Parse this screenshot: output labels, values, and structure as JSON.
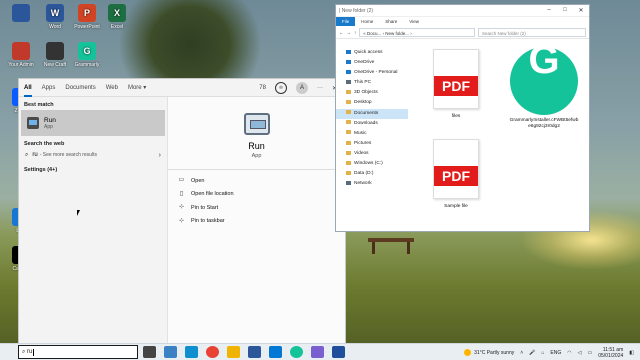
{
  "desktop": {
    "icons": [
      {
        "label": "",
        "letter": "",
        "color": "#2b579a"
      },
      {
        "label": "Word",
        "letter": "W",
        "color": "#2b579a"
      },
      {
        "label": "PowerPoint",
        "letter": "P",
        "color": "#d04423"
      },
      {
        "label": "Excel",
        "letter": "X",
        "color": "#1d6f42"
      },
      {
        "label": "Your Admin",
        "letter": "",
        "color": "#c0392b"
      },
      {
        "label": "New Craft",
        "letter": "",
        "color": "#333333"
      },
      {
        "label": "Grammarly",
        "letter": "G",
        "color": "#15c39a"
      },
      {
        "label": "Zoom",
        "letter": "",
        "color": "#0b5cff"
      },
      {
        "label": "Link",
        "letter": "",
        "color": "#1976d2"
      },
      {
        "label": "CapCut",
        "letter": "",
        "color": "#000000"
      }
    ]
  },
  "start_menu": {
    "tabs": [
      "All",
      "Apps",
      "Documents",
      "Web",
      "More"
    ],
    "active_tab": "All",
    "reward_points": "78",
    "avatar_letter": "A",
    "more_dots": "···",
    "close_glyph": "✕",
    "best_match_label": "Best match",
    "best_match": {
      "title": "Run",
      "subtitle": "App"
    },
    "search_web_label": "Search the web",
    "search_web_query": "ru",
    "search_web_more": "- See more search results",
    "settings_label": "Settings (4+)",
    "preview": {
      "title": "Run",
      "subtitle": "App",
      "actions": [
        "Open",
        "Open file location",
        "Pin to Start",
        "Pin to taskbar"
      ]
    }
  },
  "explorer": {
    "title": "| New folder (2)",
    "ribbon_tabs": [
      "File",
      "Home",
      "Share",
      "View"
    ],
    "breadcrumb": "« Docu... › New folde... ›",
    "search_placeholder": "Search New folder (2)",
    "nav_items": [
      "Quick access",
      "OneDrive",
      "OneDrive - Personal",
      "This PC",
      "3D Objects",
      "Desktop",
      "Documents",
      "Downloads",
      "Music",
      "Pictures",
      "Videos",
      "Windows (C:)",
      "Data (D:)",
      "Network"
    ],
    "selected_nav": "Documents",
    "files": [
      {
        "name": "files",
        "type": "pdf"
      },
      {
        "name": "GrammarlyInstaller.cFWBt5efwb e6g92cj3r0dg2",
        "type": "grammarly"
      },
      {
        "name": "Sample file",
        "type": "pdf"
      }
    ],
    "pdf_label": "PDF"
  },
  "taskbar": {
    "search_value": "ru",
    "weather": "31°C  Partly sunny",
    "language": "ENG",
    "time": "11:51 am",
    "date": "05/01/2024"
  }
}
